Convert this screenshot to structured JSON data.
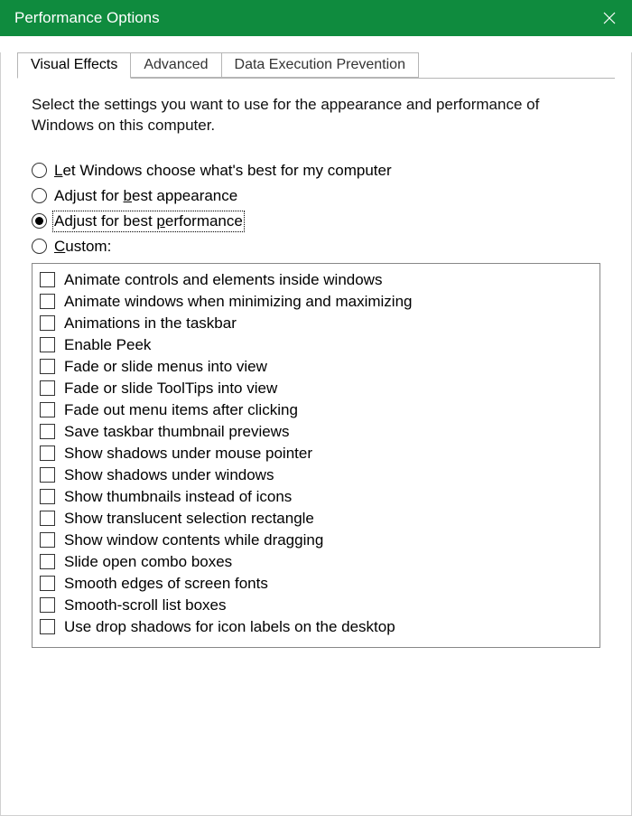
{
  "titlebar": {
    "title": "Performance Options"
  },
  "tabs": [
    {
      "label": "Visual Effects",
      "active": true
    },
    {
      "label": "Advanced",
      "active": false
    },
    {
      "label": "Data Execution Prevention",
      "active": false
    }
  ],
  "intro": "Select the settings you want to use for the appearance and performance of Windows on this computer.",
  "radio": {
    "options": [
      {
        "id": "let-windows",
        "pre": "",
        "key": "L",
        "post": "et Windows choose what's best for my computer",
        "checked": false,
        "focused": false
      },
      {
        "id": "best-appearance",
        "pre": "Adjust for ",
        "key": "b",
        "post": "est appearance",
        "checked": false,
        "focused": false
      },
      {
        "id": "best-performance",
        "pre": "Adjust for best ",
        "key": "p",
        "post": "erformance",
        "checked": true,
        "focused": true
      },
      {
        "id": "custom",
        "pre": "",
        "key": "C",
        "post": "ustom:",
        "checked": false,
        "focused": false
      }
    ]
  },
  "effects": [
    {
      "label": "Animate controls and elements inside windows",
      "checked": false
    },
    {
      "label": "Animate windows when minimizing and maximizing",
      "checked": false
    },
    {
      "label": "Animations in the taskbar",
      "checked": false
    },
    {
      "label": "Enable Peek",
      "checked": false
    },
    {
      "label": "Fade or slide menus into view",
      "checked": false
    },
    {
      "label": "Fade or slide ToolTips into view",
      "checked": false
    },
    {
      "label": "Fade out menu items after clicking",
      "checked": false
    },
    {
      "label": "Save taskbar thumbnail previews",
      "checked": false
    },
    {
      "label": "Show shadows under mouse pointer",
      "checked": false
    },
    {
      "label": "Show shadows under windows",
      "checked": false
    },
    {
      "label": "Show thumbnails instead of icons",
      "checked": false
    },
    {
      "label": "Show translucent selection rectangle",
      "checked": false
    },
    {
      "label": "Show window contents while dragging",
      "checked": false
    },
    {
      "label": "Slide open combo boxes",
      "checked": false
    },
    {
      "label": "Smooth edges of screen fonts",
      "checked": false
    },
    {
      "label": "Smooth-scroll list boxes",
      "checked": false
    },
    {
      "label": "Use drop shadows for icon labels on the desktop",
      "checked": false
    }
  ]
}
